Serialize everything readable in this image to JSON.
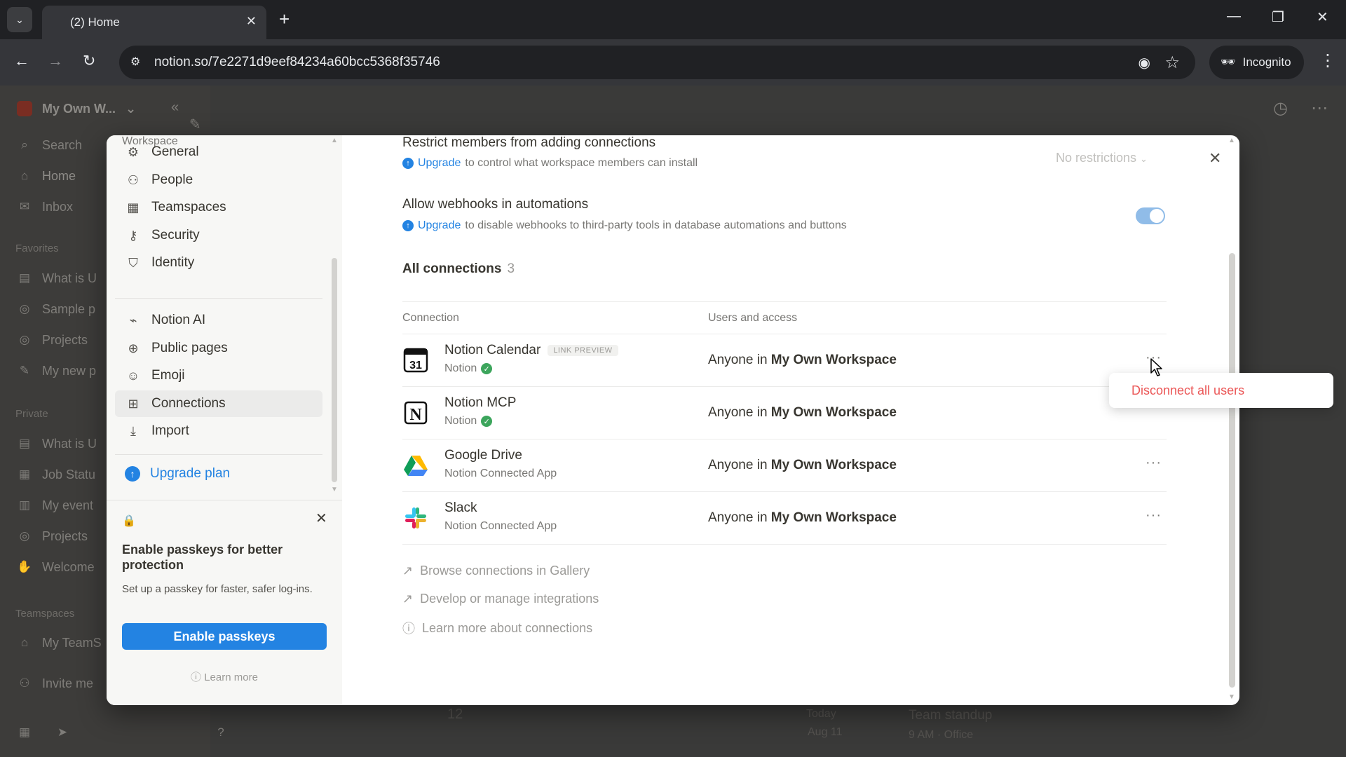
{
  "browser": {
    "tab_title": "(2) Home",
    "url": "notion.so/7e2271d9eef84234a60bcc5368f35746",
    "incognito_label": "Incognito"
  },
  "app": {
    "workspace_name": "My Own W...",
    "sidebar": {
      "top": [
        {
          "label": "Search",
          "icon": "search-icon"
        },
        {
          "label": "Home",
          "icon": "home-icon"
        },
        {
          "label": "Inbox",
          "icon": "inbox-icon"
        }
      ],
      "favorites_label": "Favorites",
      "favorites": [
        "What is U",
        "Sample p",
        "Projects",
        "My new p"
      ],
      "private_label": "Private",
      "private": [
        "What is U",
        "Job Statu",
        "My event",
        "Projects",
        "Welcome"
      ],
      "teamspaces_label": "Teamspaces",
      "teamspaces": [
        "My TeamS"
      ],
      "invite": "Invite me"
    },
    "background_fragments": {
      "today": "Today",
      "date": "Aug 11",
      "event": "Team standup",
      "event_meta": "9 AM · Office",
      "calendar_day": "12"
    }
  },
  "settings": {
    "section_label": "Workspace",
    "nav": [
      {
        "label": "General",
        "icon": "gear-icon"
      },
      {
        "label": "People",
        "icon": "people-icon"
      },
      {
        "label": "Teamspaces",
        "icon": "teamspaces-icon"
      },
      {
        "label": "Security",
        "icon": "key-icon"
      },
      {
        "label": "Identity",
        "icon": "shield-icon"
      },
      {
        "label": "Notion AI",
        "icon": "notion-ai-icon"
      },
      {
        "label": "Public pages",
        "icon": "globe-icon"
      },
      {
        "label": "Emoji",
        "icon": "emoji-icon"
      },
      {
        "label": "Connections",
        "icon": "grid-icon"
      },
      {
        "label": "Import",
        "icon": "download-icon"
      }
    ],
    "active_nav": "Connections",
    "upgrade_plan": "Upgrade plan",
    "passkey": {
      "title": "Enable passkeys for better protection",
      "description": "Set up a passkey for faster, safer log-ins.",
      "button": "Enable passkeys",
      "learn_more": "Learn more"
    },
    "restrict": {
      "title": "Restrict members from adding connections",
      "upgrade": "Upgrade",
      "desc": "to control what workspace members can install",
      "value": "No restrictions"
    },
    "webhooks": {
      "title": "Allow webhooks in automations",
      "upgrade": "Upgrade",
      "desc": "to disable webhooks to third-party tools in database automations and buttons",
      "enabled": true
    },
    "all_connections": {
      "label": "All connections",
      "count": "3"
    },
    "table": {
      "col_connection": "Connection",
      "col_access": "Users and access",
      "access_prefix": "Anyone in",
      "rows": [
        {
          "name": "Notion Calendar",
          "badge": "LINK PREVIEW",
          "sub": "Notion",
          "verified": true,
          "workspace": "My Own Workspace",
          "logo": "calendar-31-icon",
          "logo_text": "31"
        },
        {
          "name": "Notion MCP",
          "badge": "",
          "sub": "Notion",
          "verified": true,
          "workspace": "My Own Workspace",
          "logo": "notion-logo-icon",
          "logo_text": "N"
        },
        {
          "name": "Google Drive",
          "badge": "",
          "sub": "Notion Connected App",
          "verified": false,
          "workspace": "My Own Workspace",
          "logo": "google-drive-icon",
          "logo_text": ""
        },
        {
          "name": "Slack",
          "badge": "",
          "sub": "Notion Connected App",
          "verified": false,
          "workspace": "My Own Workspace",
          "logo": "slack-icon",
          "logo_text": ""
        }
      ]
    },
    "footer_links": [
      {
        "label": "Browse connections in Gallery",
        "icon": "arrow-up-right-icon"
      },
      {
        "label": "Develop or manage integrations",
        "icon": "arrow-up-right-icon"
      },
      {
        "label": "Learn more about connections",
        "icon": "question-circle-icon"
      }
    ],
    "dropdown_item": "Disconnect all users"
  },
  "colors": {
    "accent": "#2383e2",
    "danger": "#eb5757",
    "verified": "#3ca55c"
  }
}
